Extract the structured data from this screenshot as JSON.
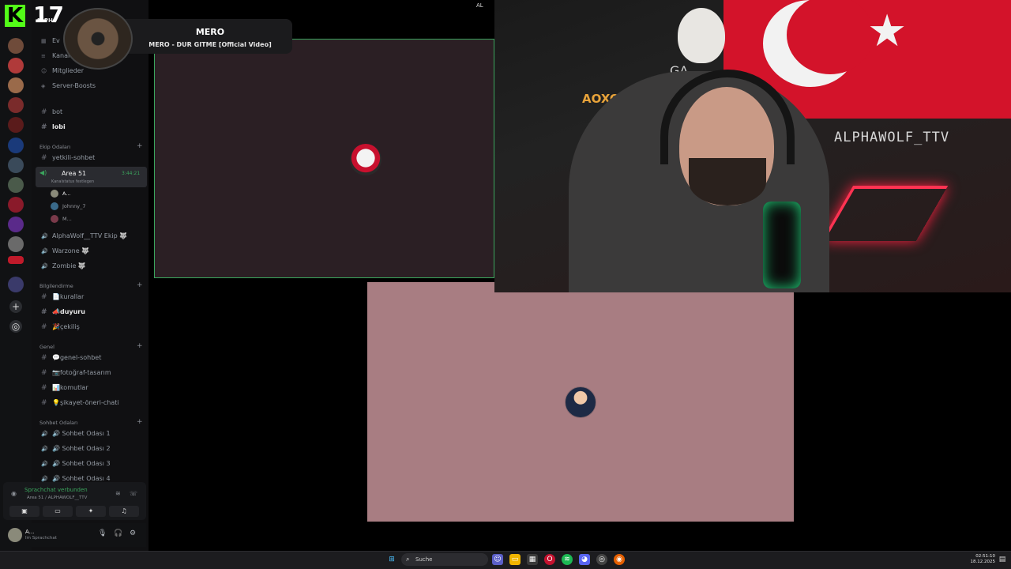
{
  "overlay": {
    "logo_letter": "K",
    "logo_number": "17",
    "now_playing_title": "MERO",
    "now_playing_track": "MERO - DUR GITME [Official Video]"
  },
  "server": {
    "name": "ALPH",
    "top_items": [
      "Ev",
      "Kanal",
      "Mitglieder",
      "Server-Boosts"
    ],
    "channels_top": [
      "bot",
      "lobi"
    ],
    "categories": {
      "ekip": "Ekip Odaları",
      "bilgi": "Bilgilendirme",
      "genel": "Genel",
      "sohbet": "Sohbet Odaları"
    },
    "ekip_text_channel": "yetkili-sohbet",
    "active_voice": {
      "name": "Area 51",
      "timer": "3:44:21",
      "status": "Kanalstatus festlegen"
    },
    "members": [
      "A...",
      "Johnny_7",
      "M..."
    ],
    "ekip_voice": [
      "AlphaWolf__TTV Ekip 🐺",
      "Warzone 🐺",
      "Zombie 🐺"
    ],
    "bilgi_channels": [
      "📄kurallar",
      "📣duyuru",
      "🎉çekiliş"
    ],
    "genel_channels": [
      "💬genel-sohbet",
      "📷fotoğraf-tasarım",
      "📊komutlar",
      "💡şikayet-öneri-chati"
    ],
    "sohbet_voice": [
      "🔊 Sohbet Odası 1",
      "🔊 Sohbet Odası 2",
      "🔊 Sohbet Odası 3",
      "🔊 Sohbet Odası 4"
    ]
  },
  "voice_panel": {
    "status": "Sprachchat verbunden",
    "channel": "Area 51 / ALPHAWOLF__TTV"
  },
  "user_panel": {
    "name": "A...",
    "status": "Im Sprachchat"
  },
  "stage": {
    "top_pill": "AL"
  },
  "webcam": {
    "wall_text": "ALPHAWOLF_TTV",
    "shelf_text": "AOXO",
    "mask_text": "GA"
  },
  "taskbar": {
    "search_label": "Suche",
    "time": "02:51:10",
    "date": "18.12.2025"
  },
  "colors": {
    "accent_green": "#3ba55d",
    "kick_green": "#53fc18",
    "tile_pink": "#a87d82",
    "flag_red": "#d3132a"
  }
}
